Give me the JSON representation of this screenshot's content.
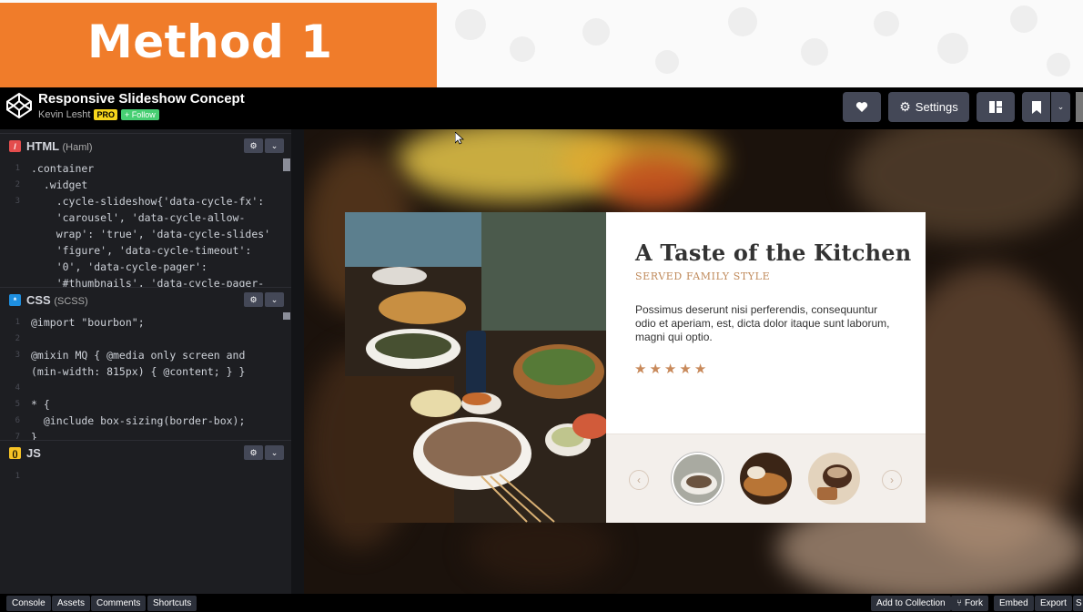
{
  "banner": {
    "label": "Method 1",
    "color": "#f07c2a"
  },
  "header": {
    "title": "Responsive Slideshow Concept",
    "author": "Kevin Lesht",
    "pro_badge": "PRO",
    "follow_label": "+ Follow",
    "settings_label": "Settings"
  },
  "panes": {
    "html": {
      "name": "HTML",
      "lang": "(Haml)",
      "lines": [
        {
          "n": "1",
          "t": ".container"
        },
        {
          "n": "2",
          "t": "  .widget"
        },
        {
          "n": "3",
          "t": "    .cycle-slideshow{'data-cycle-fx':"
        },
        {
          "n": "",
          "t": "    'carousel', 'data-cycle-allow-"
        },
        {
          "n": "",
          "t": "    wrap': 'true', 'data-cycle-slides'"
        },
        {
          "n": "",
          "t": "    'figure', 'data-cycle-timeout':"
        },
        {
          "n": "",
          "t": "    '0', 'data-cycle-pager':"
        },
        {
          "n": "",
          "t": "    '#thumbnails', 'data-cycle-pager-"
        }
      ]
    },
    "css": {
      "name": "CSS",
      "lang": "(SCSS)",
      "lines": [
        {
          "n": "1",
          "t": "@import \"bourbon\";"
        },
        {
          "n": "2",
          "t": ""
        },
        {
          "n": "3",
          "t": "@mixin MQ { @media only screen and"
        },
        {
          "n": "",
          "t": "(min-width: 815px) { @content; } }"
        },
        {
          "n": "4",
          "t": ""
        },
        {
          "n": "5",
          "t": "* {"
        },
        {
          "n": "6",
          "t": "  @include box-sizing(border-box);"
        },
        {
          "n": "7",
          "t": "}"
        }
      ]
    },
    "js": {
      "name": "JS",
      "lang": "",
      "lines": [
        {
          "n": "1",
          "t": ""
        }
      ]
    }
  },
  "card": {
    "title": "A Taste of the Kitchen",
    "subtitle": "SERVED FAMILY STYLE",
    "body": "Possimus deserunt nisi perferendis, consequuntur odio et aperiam, est, dicta dolor itaque sunt laborum, magni qui optio.",
    "rating": 5,
    "prev_arrow": "‹",
    "next_arrow": "›"
  },
  "footer": {
    "left": [
      "Console",
      "Assets",
      "Comments",
      "Shortcuts"
    ],
    "right": [
      "Add to Collection",
      "Fork",
      "Embed",
      "Export",
      "S"
    ]
  }
}
